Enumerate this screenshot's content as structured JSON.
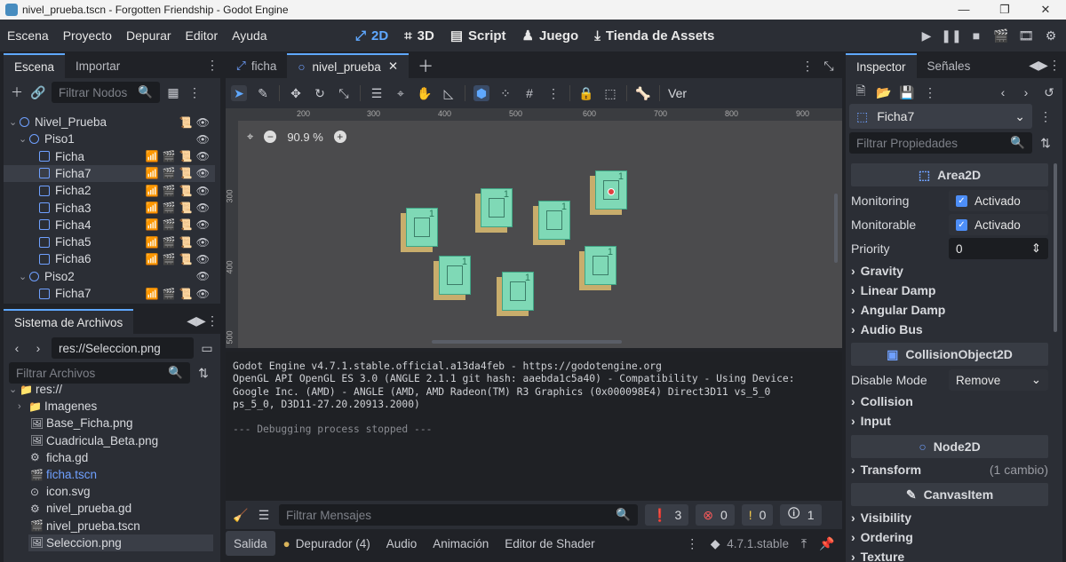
{
  "window": {
    "title": "nivel_prueba.tscn - Forgotten Friendship - Godot Engine"
  },
  "menu": {
    "items": [
      "Escena",
      "Proyecto",
      "Depurar",
      "Editor",
      "Ayuda"
    ]
  },
  "workspaces": {
    "w2d": "2D",
    "w3d": "3D",
    "script": "Script",
    "game": "Juego",
    "assets": "Tienda de Assets"
  },
  "scene_dock": {
    "tabs": [
      "Escena",
      "Importar"
    ],
    "filter_placeholder": "Filtrar Nodos",
    "nodes": [
      {
        "label": "Nivel_Prueba",
        "type": "node"
      },
      {
        "label": "Piso1",
        "type": "node"
      },
      {
        "label": "Ficha",
        "type": "area"
      },
      {
        "label": "Ficha7",
        "type": "area"
      },
      {
        "label": "Ficha2",
        "type": "area"
      },
      {
        "label": "Ficha3",
        "type": "area"
      },
      {
        "label": "Ficha4",
        "type": "area"
      },
      {
        "label": "Ficha5",
        "type": "area"
      },
      {
        "label": "Ficha6",
        "type": "area"
      },
      {
        "label": "Piso2",
        "type": "node"
      },
      {
        "label": "Ficha7",
        "type": "area"
      }
    ]
  },
  "filesystem": {
    "title": "Sistema de Archivos",
    "path": "res://Seleccion.png",
    "filter_placeholder": "Filtrar Archivos",
    "files": [
      "res://",
      "Imagenes",
      "Base_Ficha.png",
      "Cuadricula_Beta.png",
      "ficha.gd",
      "ficha.tscn",
      "icon.svg",
      "nivel_prueba.gd",
      "nivel_prueba.tscn",
      "Seleccion.png"
    ]
  },
  "editor_tabs": {
    "tab1": "ficha",
    "tab2": "nivel_prueba"
  },
  "toolbar": {
    "view": "Ver"
  },
  "viewport": {
    "zoom": "90.9 %",
    "ruler_x": [
      "200",
      "300",
      "400",
      "500",
      "600",
      "700",
      "800",
      "900"
    ],
    "ruler_y": [
      "300",
      "400",
      "500"
    ]
  },
  "output": {
    "lines": [
      "Godot Engine v4.7.1.stable.official.a13da4feb - https://godotengine.org",
      "OpenGL API OpenGL ES 3.0 (ANGLE 2.1.1 git hash: aaebda1c5a40) - Compatibility - Using Device:",
      "Google Inc. (AMD) - ANGLE (AMD, AMD Radeon(TM) R3 Graphics (0x000098E4) Direct3D11 vs_5_0",
      "ps_5_0, D3D11-27.20.20913.2000)",
      "",
      "--- Debugging process stopped ---"
    ],
    "filter_placeholder": "Filtrar Mensajes",
    "counts": {
      "messages": "3",
      "errors": "0",
      "warnings": "0",
      "editor": "1"
    }
  },
  "bottom_tabs": [
    "Salida",
    "Depurador (4)",
    "Audio",
    "Animación",
    "Editor de Shader"
  ],
  "version": "4.7.1.stable",
  "inspector": {
    "tabs": [
      "Inspector",
      "Señales"
    ],
    "node": "Ficha7",
    "filter_placeholder": "Filtrar Propiedades",
    "area2d": "Area2D",
    "monitoring_label": "Monitoring",
    "monitoring_value": "Activado",
    "monitorable_label": "Monitorable",
    "monitorable_value": "Activado",
    "priority_label": "Priority",
    "priority_value": "0",
    "groups1": [
      "Gravity",
      "Linear Damp",
      "Angular Damp",
      "Audio Bus"
    ],
    "collision_object": "CollisionObject2D",
    "disable_mode_label": "Disable Mode",
    "disable_mode_value": "Remove",
    "groups2": [
      "Collision",
      "Input"
    ],
    "node2d": "Node2D",
    "transform": "Transform",
    "transform_note": "(1 cambio)",
    "canvas_item": "CanvasItem",
    "groups3": [
      "Visibility",
      "Ordering",
      "Texture"
    ]
  },
  "colors": {
    "accent": "#5fa8ff",
    "tile_face": "#7fd9b6",
    "tile_side": "#c8ad6c"
  }
}
